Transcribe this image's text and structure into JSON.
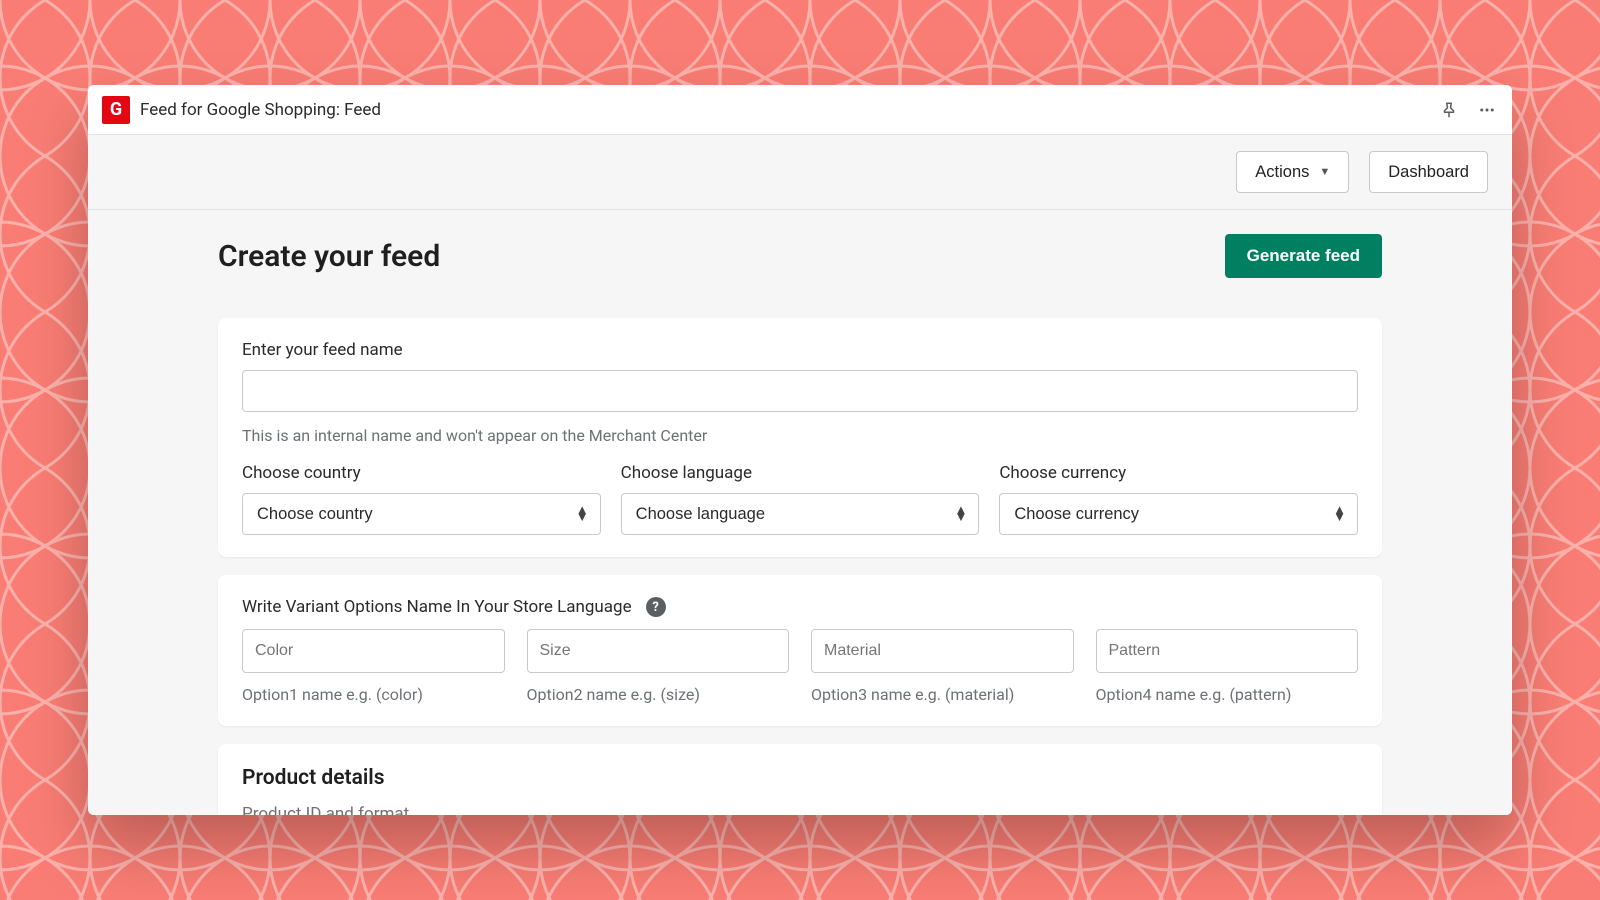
{
  "titlebar": {
    "app_letter": "G",
    "title": "Feed for Google Shopping: Feed"
  },
  "toolbar": {
    "actions_label": "Actions",
    "dashboard_label": "Dashboard"
  },
  "page": {
    "title": "Create your feed",
    "generate_label": "Generate feed"
  },
  "feed_name": {
    "label": "Enter your feed name",
    "value": "",
    "helper": "This is an internal name and won't appear on the Merchant Center"
  },
  "country": {
    "label": "Choose country",
    "selected": "Choose country"
  },
  "language": {
    "label": "Choose language",
    "selected": "Choose language"
  },
  "currency": {
    "label": "Choose currency",
    "selected": "Choose currency"
  },
  "variants": {
    "header": "Write Variant Options Name In Your Store Language",
    "opt1": {
      "placeholder": "Color",
      "helper": "Option1 name e.g. (color)"
    },
    "opt2": {
      "placeholder": "Size",
      "helper": "Option2 name e.g. (size)"
    },
    "opt3": {
      "placeholder": "Material",
      "helper": "Option3 name e.g. (material)"
    },
    "opt4": {
      "placeholder": "Pattern",
      "helper": "Option4 name e.g. (pattern)"
    }
  },
  "product_details": {
    "title": "Product details",
    "subtitle": "Product ID and format"
  }
}
